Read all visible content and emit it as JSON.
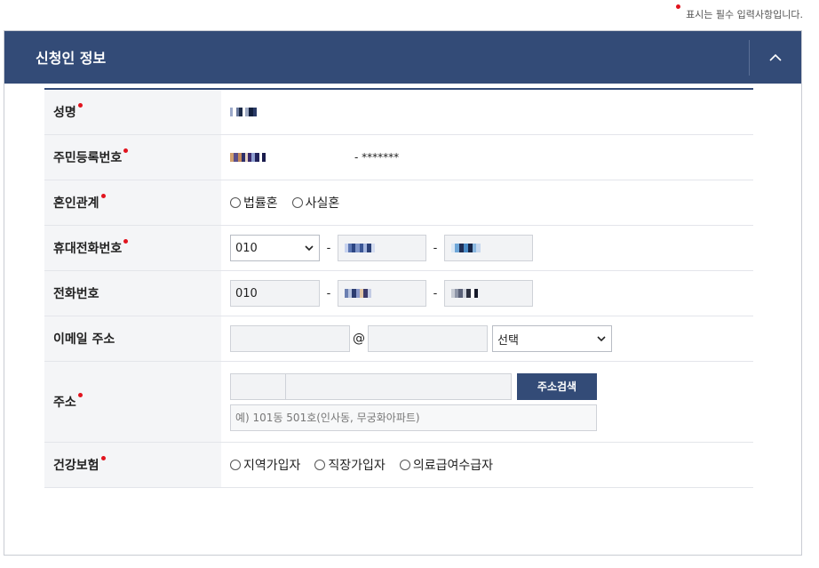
{
  "required_note": "표시는 필수 입력사항입니다.",
  "section": {
    "title": "신청인 정보"
  },
  "form": {
    "name": {
      "label": "성명"
    },
    "resident_no": {
      "label": "주민등록번호",
      "suffix": "- *******"
    },
    "marital": {
      "label": "혼인관계",
      "options": [
        "법률혼",
        "사실혼"
      ]
    },
    "mobile": {
      "label": "휴대전화번호",
      "prefix": "010",
      "dash": "-"
    },
    "phone": {
      "label": "전화번호",
      "prefix": "010",
      "dash": "-"
    },
    "email": {
      "label": "이메일 주소",
      "at": "@",
      "domain_select": "선택"
    },
    "address": {
      "label": "주소",
      "search_button": "주소검색",
      "detail_placeholder": "예) 101동 501호(인사동, 무궁화아파트)"
    },
    "insurance": {
      "label": "건강보험",
      "options": [
        "지역가입자",
        "직장가입자",
        "의료급여수급자"
      ]
    }
  },
  "colors": {
    "header": "#334b77",
    "required_dot": "#e1141e"
  }
}
